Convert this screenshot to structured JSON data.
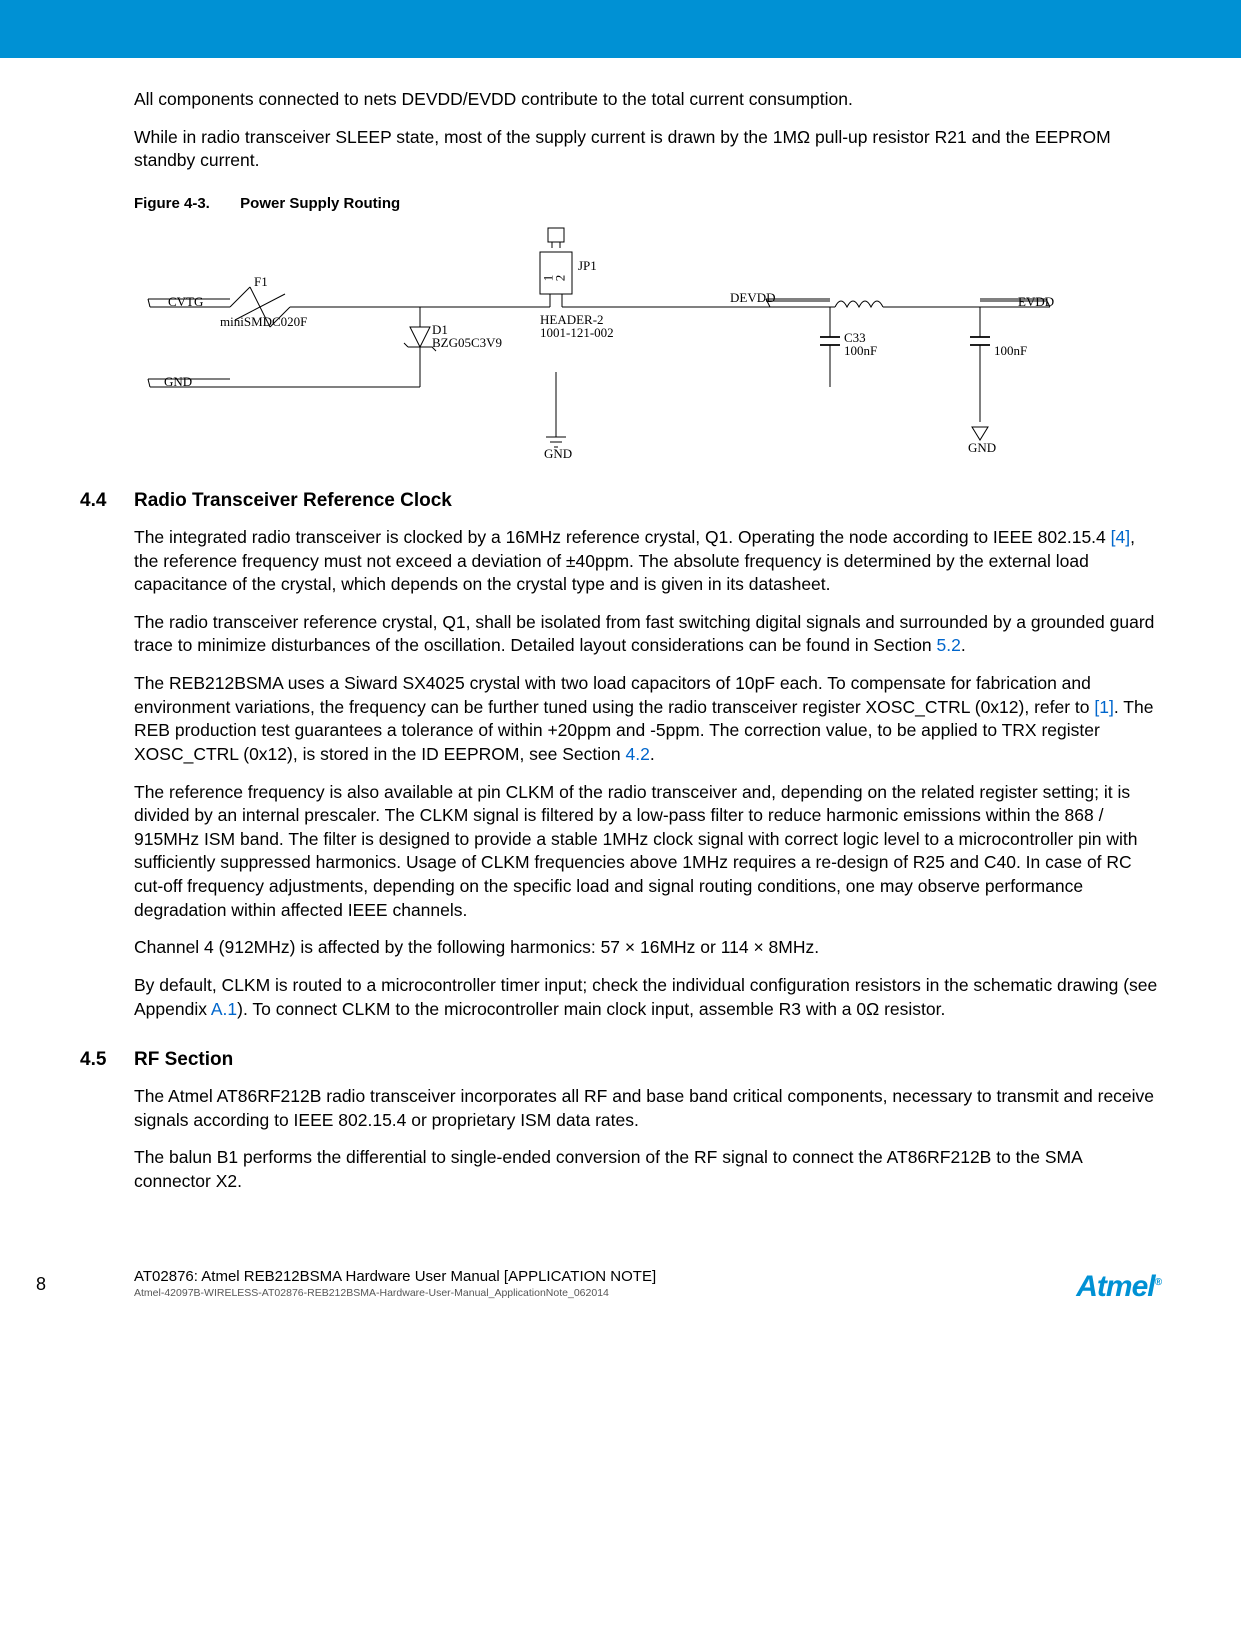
{
  "intro": {
    "p1": "All components connected to nets DEVDD/EVDD contribute to the total current consumption.",
    "p2": "While in radio transceiver SLEEP state, most of the supply current is drawn by the 1MΩ pull-up resistor R21 and the EEPROM standby current."
  },
  "figure": {
    "number": "Figure 4-3.",
    "title": "Power Supply Routing",
    "labels": {
      "cvtg": "CVTG",
      "f1": "F1",
      "minismdc": "miniSMDC020F",
      "d1": "D1",
      "d1part": "BZG05C3V9",
      "gnd": "GND",
      "jp1": "JP1",
      "jp1_1": "1",
      "jp1_2": "2",
      "header2": "HEADER-2",
      "headerpart": "1001-121-002",
      "devdd": "DEVDD",
      "c33": "C33",
      "c33val": "100nF",
      "evdd": "EVDD",
      "c_right_val": "100nF",
      "gnd_mid": "GND",
      "gnd_right": "GND"
    }
  },
  "sec44": {
    "num": "4.4",
    "title": "Radio Transceiver Reference Clock",
    "p1a": "The integrated radio transceiver is clocked by a 16MHz reference crystal, Q1. Operating the node according to IEEE 802.15.4 ",
    "ref4": "[4]",
    "p1b": ", the reference frequency must not exceed a deviation of ±40ppm. The absolute frequency is determined by the external load capacitance of the crystal, which depends on the crystal type and is given in its datasheet.",
    "p2a": "The radio transceiver reference crystal, Q1, shall be isolated from fast switching digital signals and surrounded by a grounded guard trace to minimize disturbances of the oscillation. Detailed layout considerations can be found in Section ",
    "ref52": "5.2",
    "p2b": ".",
    "p3a": "The REB212BSMA uses a Siward SX4025 crystal with two load capacitors of 10pF each. To compensate for fabrication and environment variations, the frequency can be further tuned using the radio transceiver register XOSC_CTRL (0x12), refer to ",
    "ref1": "[1]",
    "p3b": ". The REB production test guarantees a tolerance of within +20ppm and -5ppm. The correction value, to be applied to TRX register XOSC_CTRL (0x12), is stored in the ID EEPROM, see Section ",
    "ref42": "4.2",
    "p3c": ".",
    "p4": "The reference frequency is also available at pin CLKM of the radio transceiver and, depending on the related register setting; it is divided by an internal prescaler. The CLKM signal is filtered by a low-pass filter to reduce harmonic emissions within the 868 / 915MHz ISM band. The filter is designed to provide a stable 1MHz clock signal with correct logic level to a microcontroller pin with sufficiently suppressed harmonics. Usage of CLKM frequencies above 1MHz requires a re-design of R25 and C40. In case of RC cut-off frequency adjustments, depending on the specific load and signal routing conditions, one may observe performance degradation within affected IEEE channels.",
    "p5": "Channel 4 (912MHz) is affected by the following harmonics: 57 × 16MHz or 114 × 8MHz.",
    "p6a": "By default, CLKM is routed to a microcontroller timer input; check the individual configuration resistors in the schematic drawing (see Appendix ",
    "refA1": "A.1",
    "p6b": "). To connect CLKM to the microcontroller main clock input, assemble R3 with a 0Ω resistor."
  },
  "sec45": {
    "num": "4.5",
    "title": "RF Section",
    "p1": "The Atmel AT86RF212B radio transceiver incorporates all RF and base band critical components, necessary to transmit and receive signals according to IEEE 802.15.4 or proprietary ISM data rates.",
    "p2": "The balun B1 performs the differential to single-ended conversion of the RF signal to connect the AT86RF212B to the SMA connector X2."
  },
  "footer": {
    "pagenum": "8",
    "title": "AT02876: Atmel REB212BSMA Hardware User Manual [APPLICATION NOTE]",
    "sub": "Atmel-42097B-WIRELESS-AT02876-REB212BSMA-Hardware-User-Manual_ApplicationNote_062014",
    "logo": "Atmel"
  }
}
